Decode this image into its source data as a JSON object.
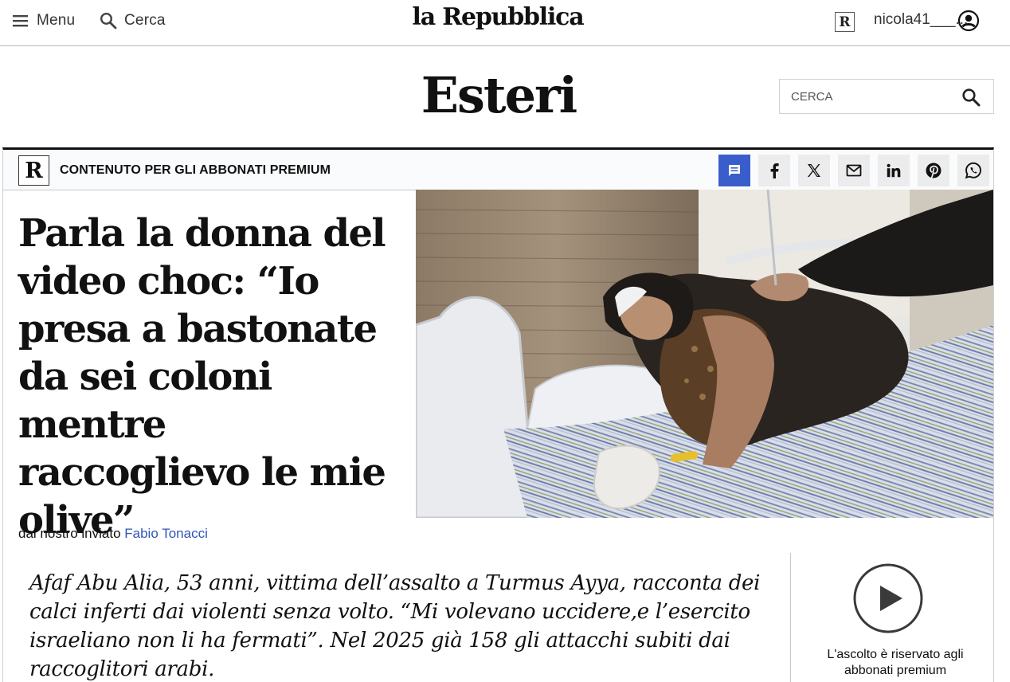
{
  "header": {
    "menu_label": "Menu",
    "search_label": "Cerca",
    "logo": "la Repubblica",
    "badge_letter": "R",
    "username": "nicola41___..."
  },
  "section": {
    "title": "Esteri",
    "search_placeholder": "CERCA"
  },
  "article": {
    "badge_letter": "R",
    "premium_label": "CONTENUTO PER GLI ABBONATI PREMIUM",
    "share_buttons": [
      "comment-icon",
      "facebook-icon",
      "x-icon",
      "mail-icon",
      "linkedin-icon",
      "pinterest-icon",
      "whatsapp-icon"
    ],
    "headline": "Parla la donna del video choc: “Io presa a bastonate da sei coloni mentre raccoglievo le mie olive”",
    "byline_prefix": "dal nostro inviato",
    "author": "Fabio Tonacci",
    "subtitle": "Afaf Abu Alia, 53 anni, vittima dell’assalto a Turmus Ayya, racconta dei calci inferti dai violenti senza volto. “Mi volevano uccidere,e l’esercito israeliano non li ha fermati”. Nel 2025 già 158 gli attacchi subiti dai raccoglitori arabi.",
    "audio_text": "L'ascolto è riservato agli abbonati premium"
  },
  "colors": {
    "accent_blue": "#3a5dcc",
    "author_link": "#2f55b8",
    "share_bg": "#ececec"
  }
}
